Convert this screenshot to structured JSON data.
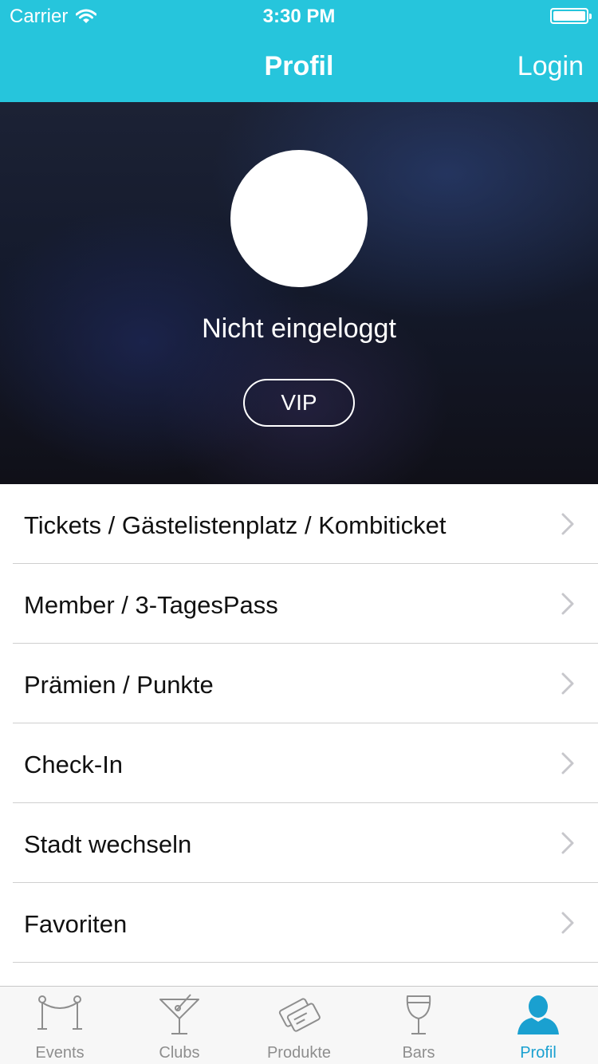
{
  "status_bar": {
    "carrier": "Carrier",
    "time": "3:30 PM",
    "wifi_icon": "wifi-icon",
    "battery_icon": "battery-icon"
  },
  "nav": {
    "title": "Profil",
    "login_label": "Login"
  },
  "profile": {
    "avatar_icon": "avatar",
    "status_text": "Nicht eingeloggt",
    "vip_label": "VIP"
  },
  "menu": {
    "items": [
      {
        "label": "Tickets / Gästelistenplatz / Kombiticket"
      },
      {
        "label": "Member / 3-TagesPass"
      },
      {
        "label": "Prämien / Punkte"
      },
      {
        "label": "Check-In"
      },
      {
        "label": "Stadt wechseln"
      },
      {
        "label": "Favoriten"
      }
    ],
    "chevron_icon": "chevron-right-icon"
  },
  "tabbar": {
    "tabs": [
      {
        "label": "Events",
        "icon": "rope-barrier-icon"
      },
      {
        "label": "Clubs",
        "icon": "cocktail-glass-icon"
      },
      {
        "label": "Produkte",
        "icon": "tickets-icon"
      },
      {
        "label": "Bars",
        "icon": "wine-glass-icon"
      },
      {
        "label": "Profil",
        "icon": "person-icon"
      }
    ],
    "active": "Profil"
  },
  "colors": {
    "accent": "#26c5dc",
    "tab_active": "#1aa0d0",
    "tab_inactive": "#8e8e8e"
  }
}
